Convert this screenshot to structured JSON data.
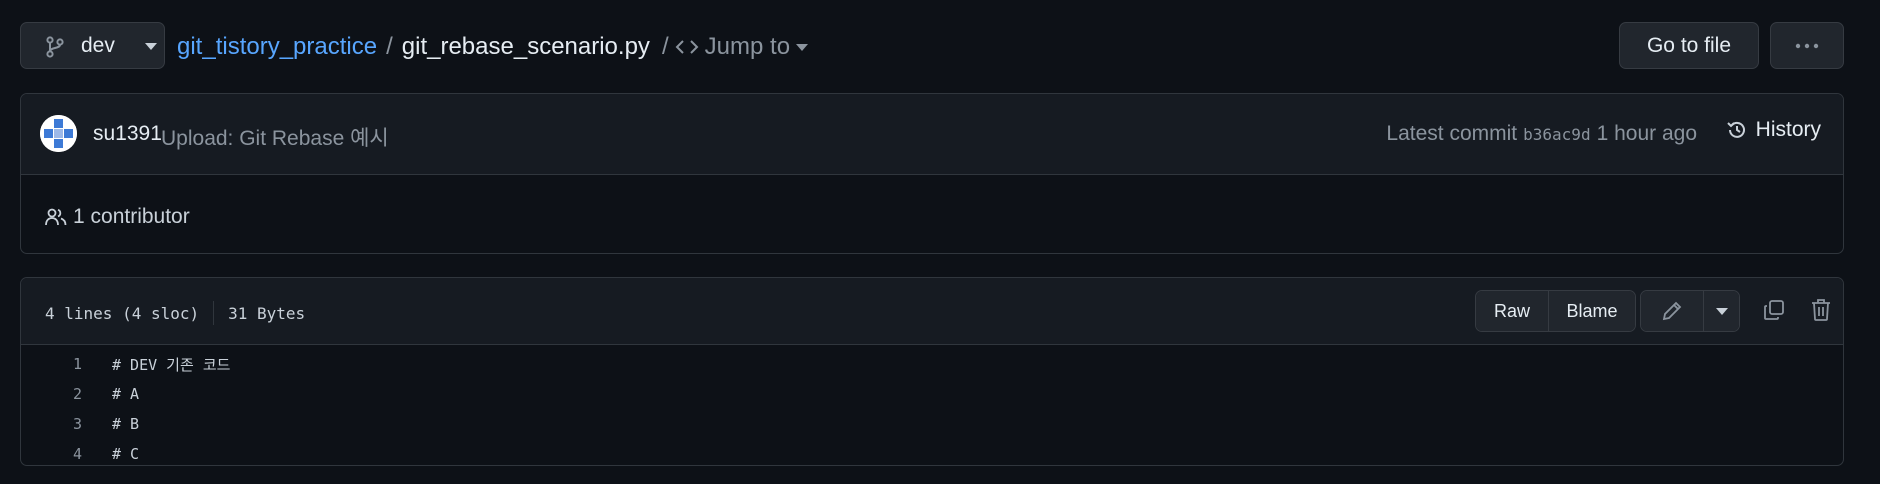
{
  "branch": {
    "name": "dev"
  },
  "breadcrumb": {
    "repo": "git_tistory_practice",
    "separator": "/",
    "file": "git_rebase_scenario.py"
  },
  "jump": {
    "separator": "/",
    "label": "Jump to"
  },
  "actions": {
    "go_to_file": "Go to file",
    "more": "more-options"
  },
  "commit": {
    "author": "su1391",
    "message": "Upload: Git Rebase 예시",
    "latest_label": "Latest commit",
    "sha": "b36ac9d",
    "time": "1 hour ago",
    "history_label": "History"
  },
  "contributors": {
    "label": "1 contributor"
  },
  "file": {
    "lines_info": "4 lines (4 sloc)",
    "size": "31 Bytes",
    "raw_label": "Raw",
    "blame_label": "Blame",
    "lines": [
      {
        "num": "1",
        "text": "# DEV 기존 코드"
      },
      {
        "num": "2",
        "text": "# A"
      },
      {
        "num": "3",
        "text": "# B"
      },
      {
        "num": "4",
        "text": "# C"
      }
    ]
  },
  "colors": {
    "background": "#0d1117",
    "link": "#58a6ff",
    "panel": "#161b22",
    "border": "#30363d"
  }
}
